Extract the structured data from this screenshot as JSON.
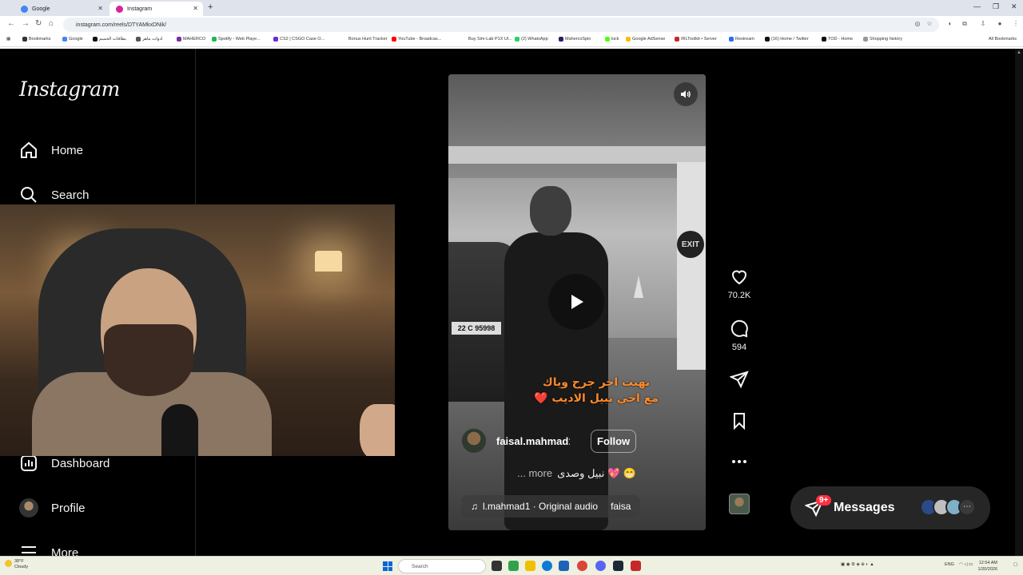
{
  "browser": {
    "tabs": [
      {
        "label": "Google",
        "active": false,
        "favicon_color": "#4285f4"
      },
      {
        "label": "Instagram",
        "active": true,
        "favicon_color": "#d6249f"
      }
    ],
    "url": "instagram.com/reels/DTYAMkxDNik/",
    "bookmarks": [
      {
        "label": "Bookmarks",
        "color": "#333333"
      },
      {
        "label": "Google",
        "color": "#4285f4"
      },
      {
        "label": "بطاقات الحسم",
        "color": "#111111"
      },
      {
        "label": "ادوات ماهر",
        "color": "#555555"
      },
      {
        "label": "MAHERCO",
        "color": "#7a2ea5"
      },
      {
        "label": "Spotify - Web Playe...",
        "color": "#1db954"
      },
      {
        "label": "CS2 | CSGO Case O...",
        "color": "#6a2ad8"
      },
      {
        "label": "Bonus Hunt Tracker",
        "color": "#ffffff"
      },
      {
        "label": "YouTube - Broadcas...",
        "color": "#ff0000"
      },
      {
        "label": "Buy Sim-Lab P1X Ul...",
        "color": "#ffffff"
      },
      {
        "label": "(2) WhatsApp",
        "color": "#25d366"
      },
      {
        "label": "MahercoSpin",
        "color": "#222266"
      },
      {
        "label": "kick",
        "color": "#53fc18"
      },
      {
        "label": "Google AdSense",
        "color": "#fbbc05"
      },
      {
        "label": "IRLToolkit • Server",
        "color": "#c62828"
      },
      {
        "label": "Restream",
        "color": "#2f6cf5"
      },
      {
        "label": "(16) Home / Twitter",
        "color": "#111111"
      },
      {
        "label": "TOD - Home",
        "color": "#111111"
      },
      {
        "label": "Shopping history",
        "color": "#999999"
      }
    ],
    "all_bookmarks": "All Bookmarks"
  },
  "instagram": {
    "logo": "Instagram",
    "nav": {
      "home": "Home",
      "search": "Search",
      "dashboard": "Dashboard",
      "profile": "Profile",
      "more": "More"
    },
    "reel": {
      "caption_line1": "نهيت اخر جرح وياك",
      "caption_line2": "مع اخي نبيل الاديب",
      "caption_heart": "❤️",
      "plate": "22 C 95998",
      "exit_sign": "EXIT",
      "username": "faisal.mahmad1",
      "follow_label": "Follow",
      "description": "نبيل وصدى 💖 😁",
      "more_label": "... more",
      "audio": "l.mahmad1 · Original audio",
      "audio_suffix": "faisa"
    },
    "actions": {
      "likes": "70.2K",
      "comments": "594"
    },
    "messages": {
      "label": "Messages",
      "badge": "9+"
    }
  },
  "taskbar": {
    "temperature": "38°F",
    "condition": "Cloudy",
    "weather_alert": "1",
    "search_placeholder": "Search",
    "language": "ENG",
    "time": "12:54 AM",
    "date": "1/20/2026"
  }
}
